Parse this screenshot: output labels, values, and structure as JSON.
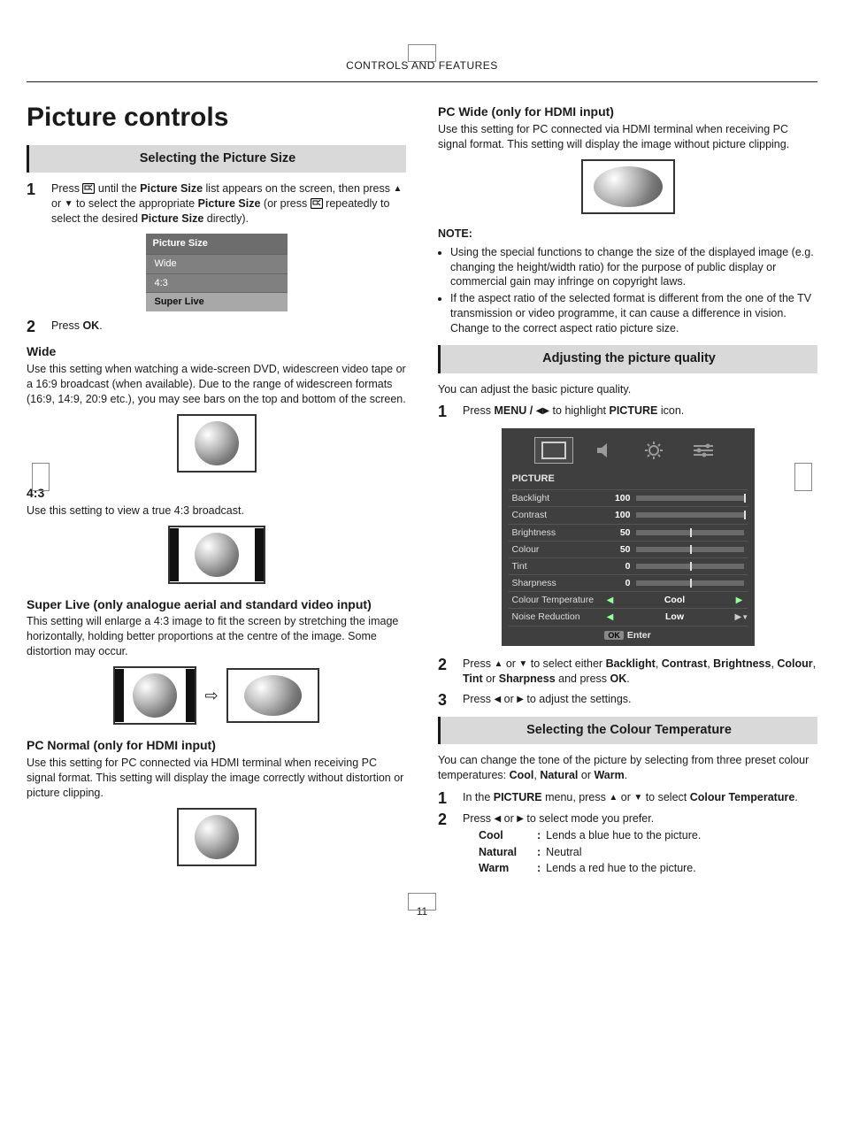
{
  "header": {
    "band": "CONTROLS AND FEATURES"
  },
  "page_number": "11",
  "left": {
    "title": "Picture controls",
    "section1_head": "Selecting the Picture Size",
    "step1": {
      "n": "1",
      "pre": "Press ",
      "mid1": " until the ",
      "b1": "Picture Size",
      "mid2": " list appears on the screen, then press ",
      "mid3": " or ",
      "mid4": " to select the appropriate ",
      "b2": "Picture Size",
      "mid5": " (or press ",
      "mid6": " repeatedly to select the desired ",
      "b3": "Picture Size",
      "end": " directly)."
    },
    "osd_psize": {
      "header": "Picture Size",
      "items": [
        "Wide",
        "4:3",
        "Super Live"
      ]
    },
    "step2": {
      "n": "2",
      "pre": "Press ",
      "b": "OK",
      "end": "."
    },
    "wide_h": "Wide",
    "wide_p": "Use this setting when watching a wide-screen DVD, widescreen video tape or a 16:9 broadcast (when available). Due to the range of widescreen formats (16:9, 14:9, 20:9 etc.), you may see bars on the top and bottom of the screen.",
    "four3_h": "4:3",
    "four3_p": "Use this setting to view a true 4:3 broadcast.",
    "super_h": "Super Live (only analogue aerial and standard video input)",
    "super_p": "This setting will enlarge a 4:3 image to fit the screen by stretching the image horizontally, holding better proportions at the centre of the image. Some distortion may occur.",
    "pcn_h": "PC Normal (only for HDMI input)",
    "pcn_p": "Use this setting for PC connected via HDMI terminal when receiving PC signal format. This setting will display the image correctly without distortion or picture clipping."
  },
  "right": {
    "pcw_h": "PC Wide (only for HDMI input)",
    "pcw_p": "Use this setting for PC connected via HDMI terminal when receiving PC signal format. This setting will display the image without picture clipping.",
    "note_h": "NOTE:",
    "notes": [
      "Using the special functions to change the size of the displayed image (e.g. changing the height/width ratio) for the purpose of public display or commercial gain may infringe on copyright laws.",
      "If the aspect ratio of the selected format is different from the one of the TV transmission or video programme, it can cause a difference in vision. Change to the correct aspect ratio picture size."
    ],
    "section2_head": "Adjusting the picture quality",
    "adj_intro": "You can adjust the basic picture quality.",
    "adj_step1": {
      "n": "1",
      "pre": "Press ",
      "b1": "MENU / ",
      "mid": " to highlight ",
      "b2": "PICTURE",
      "end": " icon."
    },
    "osd_picture": {
      "label": "PICTURE",
      "rows": [
        {
          "name": "Backlight",
          "val": "100",
          "pct": 100
        },
        {
          "name": "Contrast",
          "val": "100",
          "pct": 100
        },
        {
          "name": "Brightness",
          "val": "50",
          "pct": 50
        },
        {
          "name": "Colour",
          "val": "50",
          "pct": 50
        },
        {
          "name": "Tint",
          "val": "0",
          "pct": 50
        },
        {
          "name": "Sharpness",
          "val": "0",
          "pct": 50
        }
      ],
      "choice_rows": [
        {
          "name": "Colour Temperature",
          "val": "Cool"
        },
        {
          "name": "Noise Reduction",
          "val": "Low"
        }
      ],
      "foot_key": "OK",
      "foot_label": "Enter"
    },
    "adj_step2": {
      "n": "2",
      "pre": "Press ",
      "mid1": " or ",
      "mid2": " to select either ",
      "opts": [
        "Backlight",
        "Contrast",
        "Brightness",
        "Colour",
        "Tint",
        "Sharpness"
      ],
      "join_last": " and press ",
      "b_end": "OK",
      "end": "."
    },
    "adj_step3": {
      "n": "3",
      "pre": "Press ",
      "mid": " or ",
      "end": " to adjust the settings."
    },
    "section3_head": "Selecting the Colour Temperature",
    "ct_intro_pre": "You can change the tone of the picture by selecting from three preset colour temperatures: ",
    "ct_opts": [
      "Cool",
      "Natural",
      "Warm"
    ],
    "ct_intro_end": ".",
    "ct_step1": {
      "n": "1",
      "pre": "In the ",
      "b1": "PICTURE",
      "mid": " menu, press ",
      "mid2": " or ",
      "mid3": " to select ",
      "b2": "Colour Temperature",
      "end": "."
    },
    "ct_step2": {
      "n": "2",
      "pre": "Press ",
      "mid": " or ",
      "end": " to select mode you prefer."
    },
    "ct_defs": [
      {
        "k": "Cool",
        "v": "Lends a blue hue to the picture."
      },
      {
        "k": "Natural",
        "v": "Neutral"
      },
      {
        "k": "Warm",
        "v": "Lends a red hue to the picture."
      }
    ]
  }
}
